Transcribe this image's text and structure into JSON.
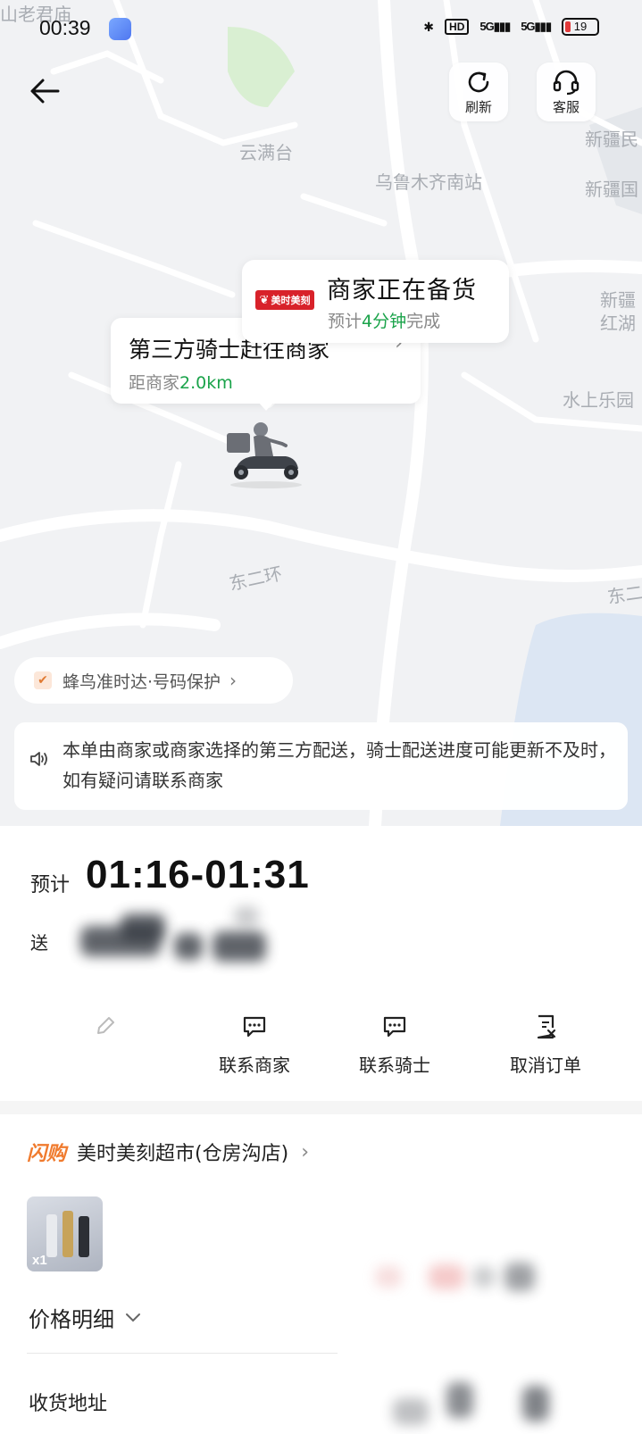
{
  "status_bar": {
    "time": "00:39",
    "hd": "HD",
    "signal1": "5G",
    "signal2": "5G",
    "battery": "19"
  },
  "header": {
    "refresh_label": "刷新",
    "service_label": "客服"
  },
  "map": {
    "labels": [
      "山老君庙",
      "云满台",
      "乌鲁木齐南站",
      "新疆民",
      "新疆国",
      "新疆",
      "红湖",
      "水上乐园",
      "东二环",
      "东二"
    ]
  },
  "merchant_bubble": {
    "logo_text": "美时美刻",
    "status": "商家正在备货",
    "eta_prefix": "预计",
    "eta_value": "4分钟",
    "eta_suffix": "完成"
  },
  "rider_bubble": {
    "status": "第三方骑士赶往商家",
    "dist_prefix": "距商家",
    "dist_value": "2.0km"
  },
  "guarantee": {
    "text": "蜂鸟准时达·号码保护"
  },
  "notice": {
    "text": "本单由商家或商家选择的第三方配送，骑士配送进度可能更新不及时，如有疑问请联系商家"
  },
  "delivery": {
    "eta_label": "预计",
    "eta_time": "01:16-01:31",
    "send_label": "送"
  },
  "actions": [
    {
      "label": ""
    },
    {
      "label": "联系商家"
    },
    {
      "label": "联系骑士"
    },
    {
      "label": "取消订单"
    }
  ],
  "shop": {
    "tag": "闪购",
    "name": "美时美刻超市(仓房沟店)"
  },
  "product": {
    "qty": "x1"
  },
  "price": {
    "label": "价格明细"
  },
  "address": {
    "label": "收货地址"
  }
}
